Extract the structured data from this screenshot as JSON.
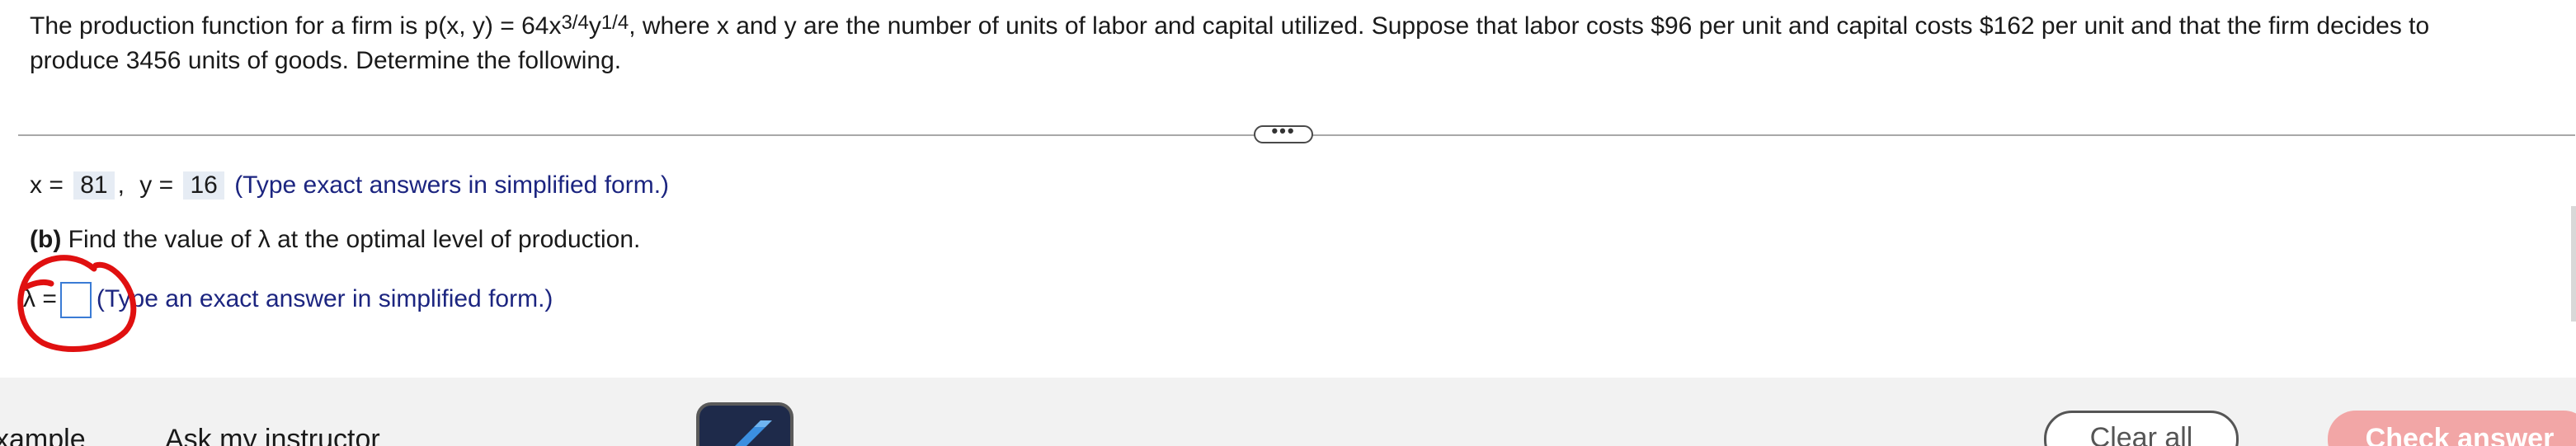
{
  "question": {
    "line1_prefix": "The production function for a firm is p(x, y) = 64x",
    "exp_x": "3/4",
    "var_y": "y",
    "exp_y": "1/4",
    "line1_suffix": ", where x and y are the number of units of labor and capital utilized.  Suppose that labor costs $96 per unit and capital costs $162 per unit and that the firm decides to",
    "line2": "produce 3456 units of goods.  Determine the following."
  },
  "expand_label": "•••",
  "answers": {
    "x_label": "x =",
    "x_value": "81",
    "comma": ",",
    "y_label": "y =",
    "y_value": "16",
    "xy_hint": "(Type exact answers in simplified form.)",
    "part_b_label": "(b)",
    "part_b_text": " Find the value of λ at the optimal level of production.",
    "lambda_label": "λ =",
    "lambda_hint": "(Type an exact answer in simplified form.)"
  },
  "footer": {
    "example_label": "xample",
    "instructor_label": "Ask my instructor",
    "clear_all_label": "Clear all",
    "check_answer_label": "Check answer"
  },
  "colors": {
    "hint_text": "#1c2580",
    "input_border": "#3a7bd5",
    "annotation": "#e01010",
    "check_answer_bg": "#f2a6a6"
  }
}
